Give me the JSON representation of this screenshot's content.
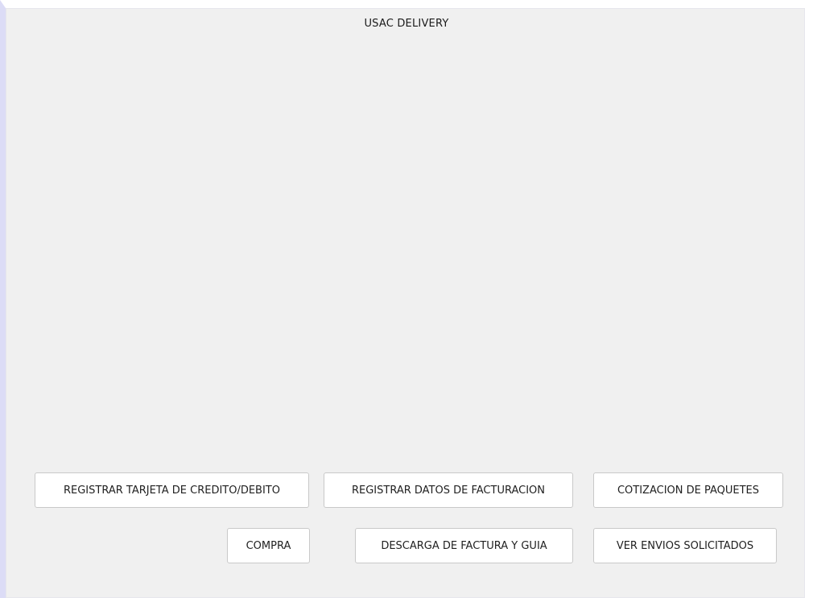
{
  "window": {
    "title": "USAC DELIVERY"
  },
  "buttons": {
    "registrar_tarjeta": "REGISTRAR TARJETA DE CREDITO/DEBITO",
    "registrar_datos": "REGISTRAR DATOS DE FACTURACION",
    "cotizacion": "COTIZACION DE PAQUETES",
    "compra": "COMPRA",
    "descarga": "DESCARGA DE FACTURA Y GUIA",
    "ver_envios": "VER ENVIOS SOLICITADOS"
  }
}
